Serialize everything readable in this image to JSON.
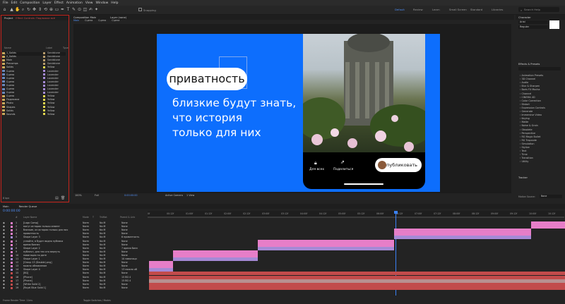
{
  "menu": [
    "File",
    "Edit",
    "Composition",
    "Layer",
    "Effect",
    "Animation",
    "View",
    "Window",
    "Help"
  ],
  "toolbar": {
    "snapping": "Snapping",
    "workspaces": [
      {
        "label": "Default",
        "active": true
      },
      {
        "label": "Review",
        "active": false
      },
      {
        "label": "Learn",
        "active": false
      },
      {
        "label": "Small Screen",
        "active": false
      },
      {
        "label": "Standard",
        "active": false
      },
      {
        "label": "Libraries",
        "active": false
      }
    ],
    "search_placeholder": "Search Help"
  },
  "project": {
    "tabs": [
      "Project",
      "Effect Controls: Подложка всё"
    ],
    "search_placeholder": "",
    "columns": [
      "Name",
      "Label",
      "Type"
    ],
    "items": [
      {
        "name": "1_Solids",
        "label": "Sandstone",
        "color": "#b79b6b"
      },
      {
        "name": "2_Solids",
        "label": "Sandstone",
        "color": "#b79b6b"
      },
      {
        "name": "Main",
        "label": "Sandstone",
        "color": "#b79b6b"
      },
      {
        "name": "Precomps",
        "label": "Sandstone",
        "color": "#b79b6b"
      },
      {
        "name": "Solids",
        "label": "Yellow",
        "color": "#e6d84e"
      },
      {
        "name": "Сцена",
        "label": "Lavender",
        "color": "#a58ad6"
      },
      {
        "name": "Сцена",
        "label": "Lavender",
        "color": "#a58ad6"
      },
      {
        "name": "Сцена",
        "label": "Lavender",
        "color": "#a58ad6"
      },
      {
        "name": "Сцена",
        "label": "Lavender",
        "color": "#a58ad6"
      },
      {
        "name": "Сцена",
        "label": "Lavender",
        "color": "#a58ad6"
      },
      {
        "name": "Сцена",
        "label": "Lavender",
        "color": "#a58ad6"
      },
      {
        "name": "Сцена",
        "label": "Lavender",
        "color": "#a58ad6"
      },
      {
        "name": "Сцена",
        "label": "Yellow",
        "color": "#e6d84e"
      },
      {
        "name": "Подложка",
        "label": "Yellow",
        "color": "#e6d84e"
      },
      {
        "name": "Photo",
        "label": "Yellow",
        "color": "#e6d84e"
      },
      {
        "name": "Shapes",
        "label": "Yellow",
        "color": "#e6d84e"
      },
      {
        "name": "Solids",
        "label": "Yellow",
        "color": "#e6d84e"
      },
      {
        "name": "Sounds",
        "label": "Yellow",
        "color": "#e6d84e"
      }
    ],
    "footer": "8 bpc"
  },
  "composition": {
    "tab": "Composition Main",
    "footage_tab": "Layer (none)",
    "subtabs": [
      "Main",
      "Сцена",
      "Сцена",
      "Сцена"
    ],
    "zoom": "100%",
    "quality": "Full",
    "timecode": "0:00:00:00",
    "active_camera": "Active Camera",
    "views": "1 View"
  },
  "canvas": {
    "pill": "приватность",
    "text": [
      "близкие будут знать,",
      "что история",
      "только для них"
    ],
    "phone": {
      "btn1": "Для всех",
      "btn2": "Поделиться",
      "publish": "Опубликовать"
    }
  },
  "right": {
    "character_tab": "Character",
    "font": "Arial",
    "style": "Regular",
    "effects_tab": "Effects & Presets",
    "effects": [
      "Animation Presets",
      "3D Channel",
      "Audio",
      "Blur & Sharpen",
      "Boris FX Mocha",
      "Channel",
      "CINEMA 4D",
      "Color Correction",
      "Distort",
      "Expression Controls",
      "Generate",
      "Immersive Video",
      "Keying",
      "Matte",
      "Noise & Grain",
      "Obsolete",
      "Perspective",
      "RG Magic Bullet",
      "RG Trapcode",
      "Simulation",
      "Stylize",
      "Text",
      "Time",
      "Transition",
      "Utility"
    ],
    "tracker_tab": "Tracker",
    "motion_source_label": "Motion Source:",
    "motion_source_value": "None"
  },
  "timeline": {
    "tabs": [
      "Main",
      "Render Queue"
    ],
    "timecode": "0:00:00:00",
    "columns": [
      "#",
      "Layer Name",
      "Mode",
      "T",
      "TrkMat",
      "Parent & Link"
    ],
    "layers": [
      {
        "n": "1",
        "name": "[Logo Comp]",
        "mode": "Norm",
        "trk": "No M",
        "parent": "None",
        "color": "#e67ec8"
      },
      {
        "n": "2",
        "name": "могут истории только инвент",
        "mode": "Norm",
        "trk": "No M",
        "parent": "None",
        "color": "#e67ec8"
      },
      {
        "n": "3",
        "name": "близкие, из истории только для них",
        "mode": "Norm",
        "trk": "No M",
        "parent": "None",
        "color": "#e67ec8"
      },
      {
        "n": "4",
        "name": "приватность",
        "mode": "Norm",
        "trk": "No M",
        "parent": "None",
        "color": "#e67ec8"
      },
      {
        "n": "5",
        "name": "Shape Layer 3",
        "mode": "Norm",
        "trk": "No M",
        "parent": "6 приватность",
        "color": "#a58ad6"
      },
      {
        "n": "6",
        "name": "узнайте, в будет видно публика",
        "mode": "Norm",
        "trk": "No M",
        "parent": "None",
        "color": "#e67ec8"
      },
      {
        "n": "7",
        "name": "время бизнес",
        "mode": "Norm",
        "trk": "No M",
        "parent": "None",
        "color": "#e67ec8"
      },
      {
        "n": "8",
        "name": "Shape Layer 2",
        "mode": "Norm",
        "trk": "No M",
        "parent": "7 время бизн",
        "color": "#a58ad6"
      },
      {
        "n": "9",
        "name": "публичн, для тех кто вернуть",
        "mode": "Norm",
        "trk": "No M",
        "parent": "None",
        "color": "#e67ec8"
      },
      {
        "n": "10",
        "name": "навигация по дате",
        "mode": "Norm",
        "trk": "No M",
        "parent": "None",
        "color": "#e67ec8"
      },
      {
        "n": "11",
        "name": "Shape Layer 1",
        "mode": "Norm",
        "trk": "No M",
        "parent": "10 навигаци",
        "color": "#a58ad6"
      },
      {
        "n": "12",
        "name": "[Group 13 (Double).png]",
        "mode": "Norm",
        "trk": "No M",
        "parent": "None",
        "color": "#e67ec8"
      },
      {
        "n": "13",
        "name": "можно обновление",
        "mode": "Norm",
        "trk": "No M",
        "parent": "None",
        "color": "#e67ec8"
      },
      {
        "n": "14",
        "name": "Shape Layer 4",
        "mode": "Norm",
        "trk": "No M",
        "parent": "13 можно об",
        "color": "#a58ad6"
      },
      {
        "n": "15",
        "name": "[BG]",
        "mode": "Norm",
        "trk": "No M",
        "parent": "None",
        "color": "#c24b4b"
      },
      {
        "n": "16",
        "name": "[Phone]",
        "mode": "Norm",
        "trk": "No M",
        "parent": "15 BG 4",
        "color": "#c24b4b"
      },
      {
        "n": "17",
        "name": "[Phone]",
        "mode": "Norm",
        "trk": "No M",
        "parent": "15 BG 4",
        "color": "#c24b4b"
      },
      {
        "n": "18",
        "name": "[White Solid 2]",
        "mode": "Norm",
        "trk": "No M",
        "parent": "None",
        "color": "#c24b4b"
      },
      {
        "n": "19",
        "name": "[Royal Blue Solid 1]",
        "mode": "Norm",
        "trk": "No M",
        "parent": "None",
        "color": "#c24b4b"
      }
    ],
    "ruler": [
      "0f",
      "00:12f",
      "01:00f",
      "01:12f",
      "02:00f",
      "02:12f",
      "03:00f",
      "03:12f",
      "04:00f",
      "04:12f",
      "05:00f",
      "05:12f",
      "06:00f",
      "06:12f",
      "07:00f",
      "07:12f",
      "08:00f",
      "08:12f",
      "09:00f",
      "09:12f",
      "10:00f",
      "10:12f"
    ],
    "footer_left": "Frame Render Time: 11ms",
    "footer_mid": "Toggle Switches / Modes"
  }
}
